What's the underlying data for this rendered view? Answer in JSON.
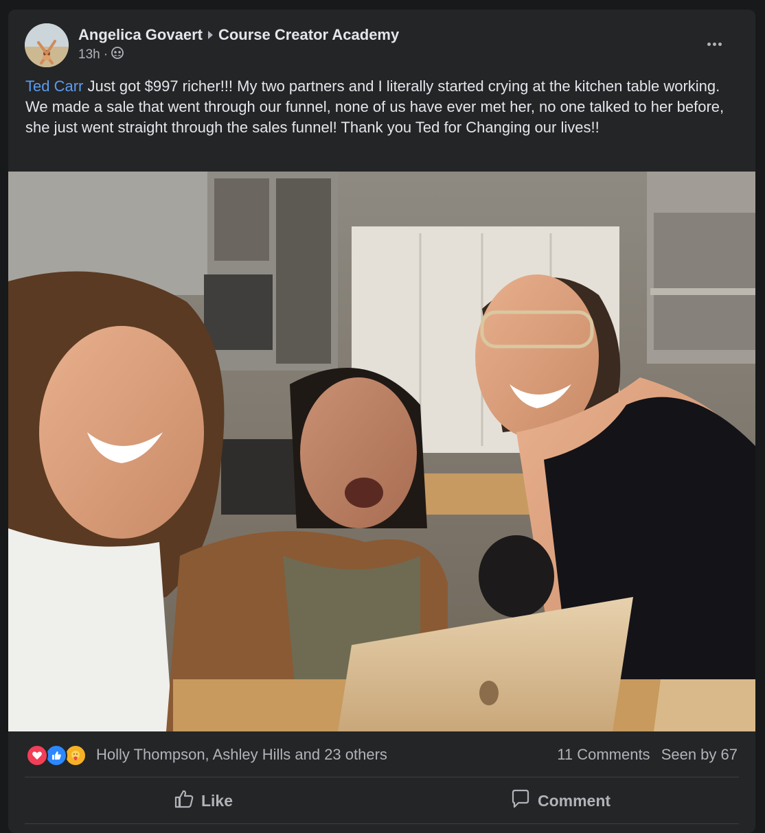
{
  "post": {
    "author": "Angelica Govaert",
    "group": "Course Creator Academy",
    "time": "13h",
    "mention": "Ted Carr",
    "body": " Just got $997 richer!!! My two partners and I literally started crying at the kitchen table working.  We made a sale that went through our funnel, none of us have ever met her, no one talked to her before, she just went straight through the sales funnel! Thank you Ted for Changing our lives!!"
  },
  "icons": {
    "audience": "group-audience-icon",
    "more": "more-options-icon",
    "like": "thumbs-up-icon",
    "comment": "comment-bubble-icon",
    "reactions": [
      "love-reaction-icon",
      "like-reaction-icon",
      "care-reaction-icon"
    ]
  },
  "photo": {
    "description_visible": ""
  },
  "reactions": {
    "names": "Holly Thompson, Ashley Hills and 23 others",
    "comments": "11 Comments",
    "seen": "Seen by 67"
  },
  "actions": {
    "like": "Like",
    "comment": "Comment"
  },
  "colors": {
    "card_bg": "#242526",
    "page_bg": "#18191a",
    "link": "#5b9cf0",
    "text": "#e4e6eb",
    "muted": "#b0b3b8"
  }
}
